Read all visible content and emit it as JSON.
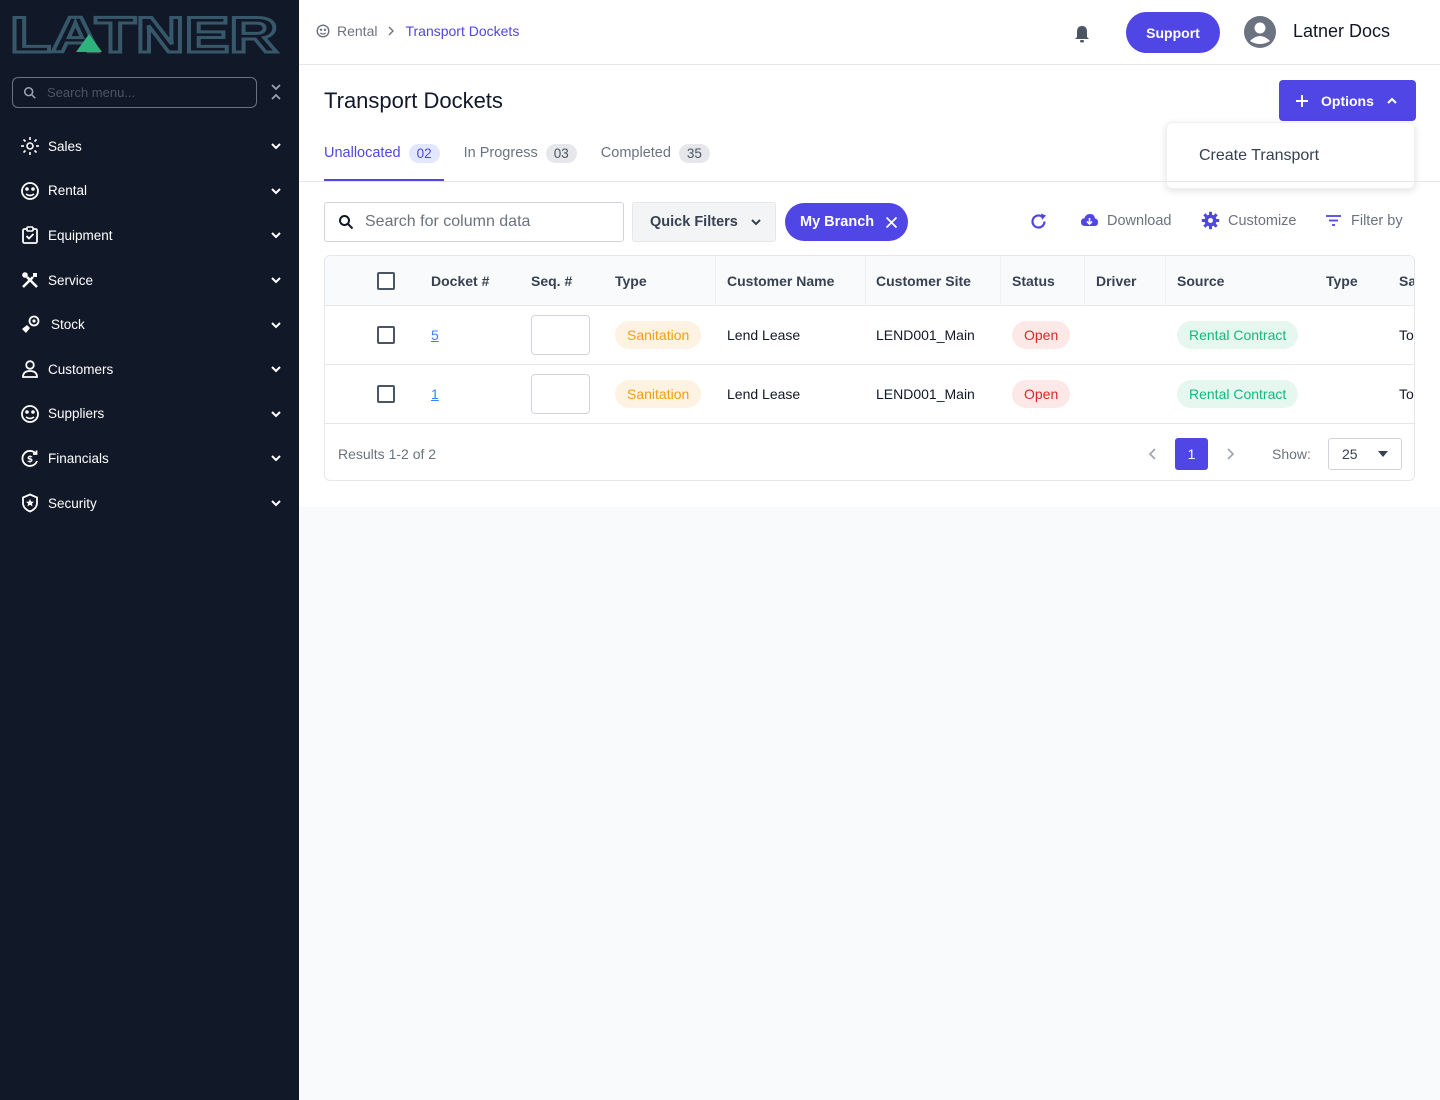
{
  "brand": {
    "logo_text": "LATNER"
  },
  "sidebar": {
    "search_placeholder": "Search menu...",
    "items": [
      {
        "label": "Sales",
        "icon": "sales-icon"
      },
      {
        "label": "Rental",
        "icon": "rental-icon"
      },
      {
        "label": "Equipment",
        "icon": "equipment-icon"
      },
      {
        "label": "Service",
        "icon": "service-icon"
      },
      {
        "label": "Stock",
        "icon": "stock-icon"
      },
      {
        "label": "Customers",
        "icon": "customers-icon"
      },
      {
        "label": "Suppliers",
        "icon": "suppliers-icon"
      },
      {
        "label": "Financials",
        "icon": "financials-icon"
      },
      {
        "label": "Security",
        "icon": "security-icon"
      }
    ]
  },
  "header": {
    "breadcrumb": [
      "Rental",
      "Transport Dockets"
    ],
    "support_label": "Support",
    "user_name": "Latner Docs"
  },
  "page": {
    "title": "Transport Dockets",
    "options_label": "Options",
    "options_menu": [
      "Create Transport"
    ],
    "tabs": [
      {
        "label": "Unallocated",
        "count": "02",
        "active": true
      },
      {
        "label": "In Progress",
        "count": "03",
        "active": false
      },
      {
        "label": "Completed",
        "count": "35",
        "active": false
      }
    ]
  },
  "toolbar": {
    "search_placeholder": "Search for column data",
    "quick_filters_label": "Quick Filters",
    "chip_label": "My Branch",
    "download_label": "Download",
    "customize_label": "Customize",
    "filter_label": "Filter by"
  },
  "table": {
    "columns": [
      "Docket #",
      "Seq. #",
      "Type",
      "Customer Name",
      "Customer Site",
      "Status",
      "Driver",
      "Source",
      "Type",
      "Sa"
    ],
    "rows": [
      {
        "docket": "5",
        "seq": "",
        "type": "Sanitation",
        "customer_name": "Lend Lease",
        "customer_site": "LEND001_Main",
        "status": "Open",
        "driver": "",
        "source": "Rental Contract",
        "type2": "",
        "sa": "To"
      },
      {
        "docket": "1",
        "seq": "",
        "type": "Sanitation",
        "customer_name": "Lend Lease",
        "customer_site": "LEND001_Main",
        "status": "Open",
        "driver": "",
        "source": "Rental Contract",
        "type2": "",
        "sa": "To"
      }
    ],
    "results_text": "Results 1-2 of 2",
    "current_page": "1",
    "show_label": "Show:",
    "page_size": "25"
  },
  "colors": {
    "sidebar_bg": "#111827",
    "accent": "#4f46e5",
    "logo": "#37586a",
    "logo_accent": "#2fb37c"
  }
}
